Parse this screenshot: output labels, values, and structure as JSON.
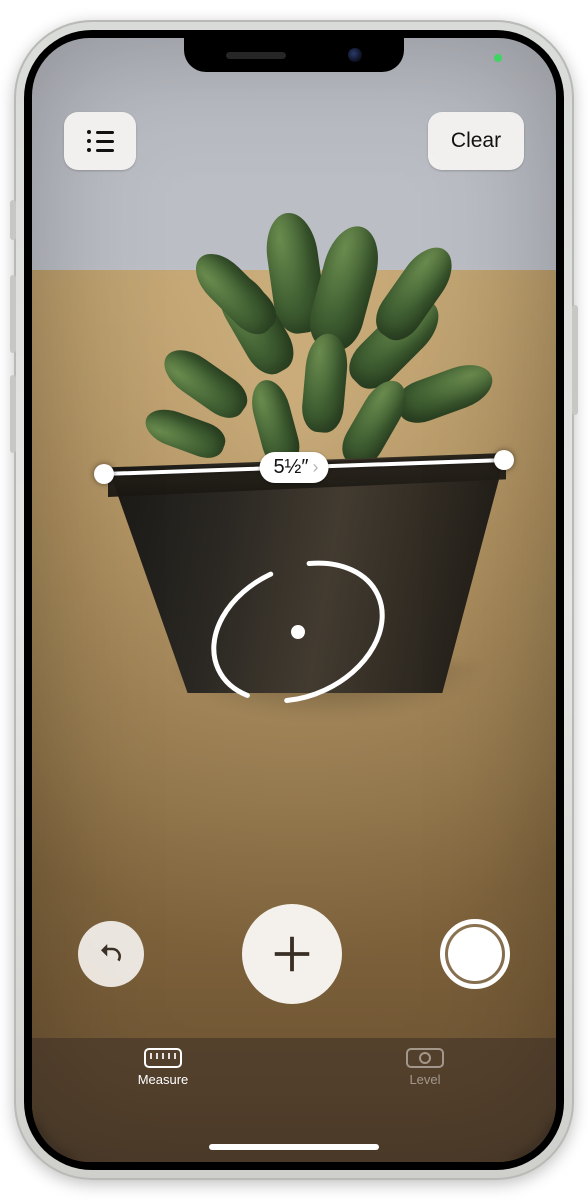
{
  "header": {
    "clear_label": "Clear"
  },
  "measurement": {
    "value_label": "5½″"
  },
  "tabs": {
    "measure_label": "Measure",
    "level_label": "Level",
    "active": "measure"
  },
  "icons": {
    "list": "list-icon",
    "undo": "undo-icon",
    "add": "plus-icon",
    "shutter": "shutter-icon",
    "ruler": "ruler-icon",
    "level": "level-icon",
    "chevron": "chevron-right-icon"
  }
}
